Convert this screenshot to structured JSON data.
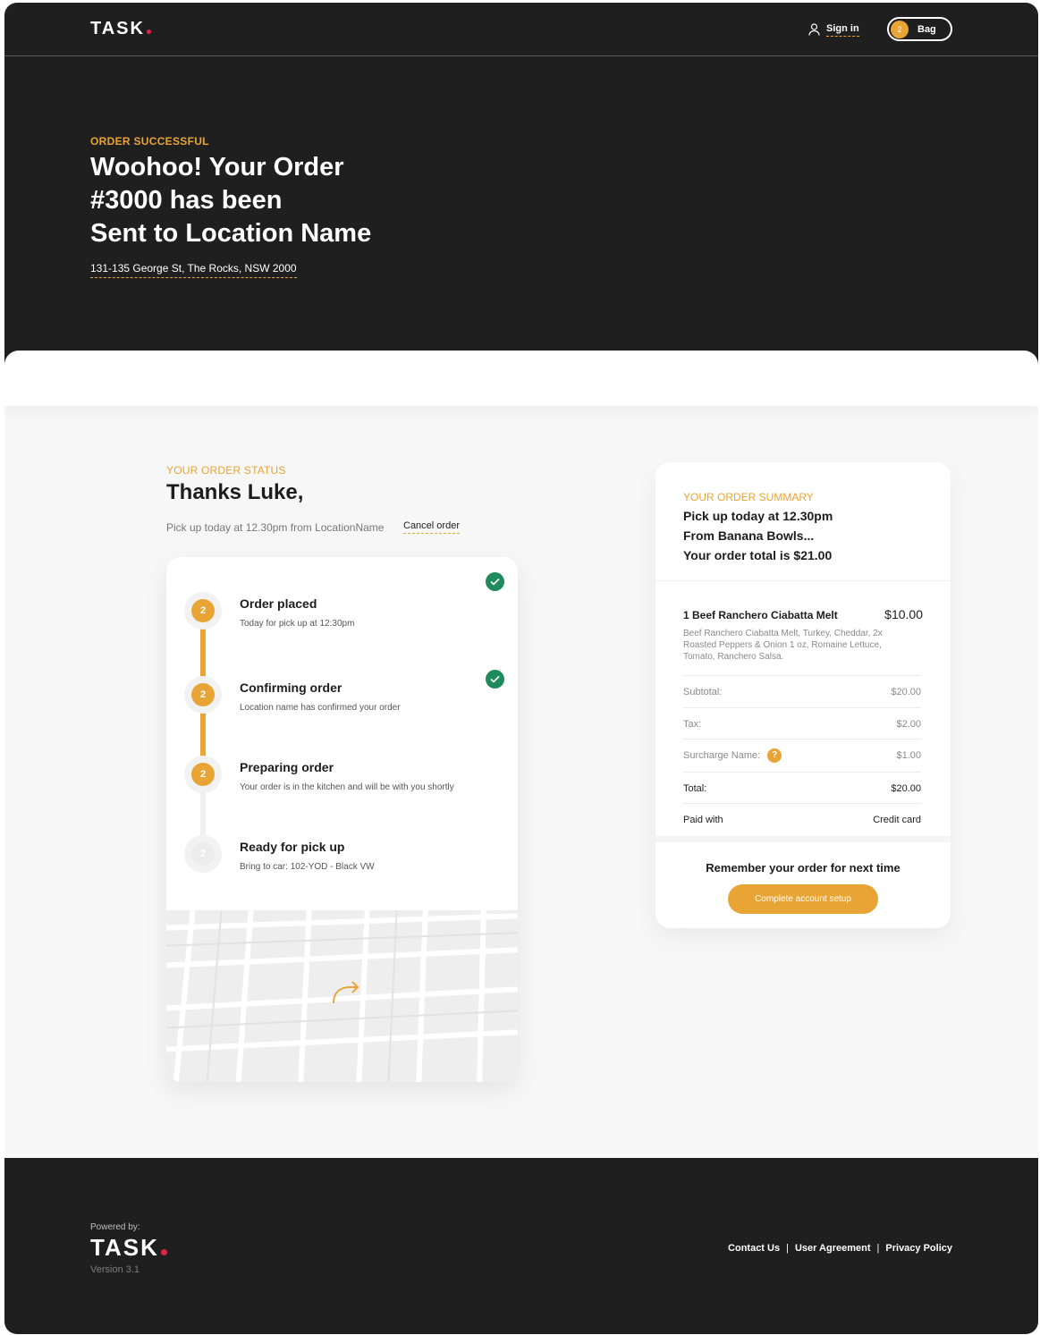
{
  "brand": {
    "name": "TASK",
    "accent": "#e8a434",
    "dot_color": "#e0234b",
    "dark_bg": "#1f1f1f",
    "success": "#1f8a5b"
  },
  "header": {
    "sign_in_label": "Sign in",
    "bag_label": "Bag",
    "bag_count": "2",
    "icons": {
      "sign_in": "user-icon"
    }
  },
  "hero": {
    "eyebrow": "ORDER SUCCESSFUL",
    "title_line1": "Woohoo! Your Order",
    "title_line2": "#3000 has been",
    "title_line3": "Sent to Location Name",
    "address": "131-135 George St, The Rocks, NSW 2000"
  },
  "status": {
    "eyebrow": "YOUR ORDER STATUS",
    "title": "Thanks Luke,",
    "subtitle": "Pick up today at 12.30pm from LocationName",
    "cancel_label": "Cancel order",
    "steps": [
      {
        "number": "2",
        "title": "Order placed",
        "description": "Today for pick up at 12:30pm",
        "state": "complete",
        "checked": true
      },
      {
        "number": "2",
        "title": "Confirming order",
        "description": "Location name has confirmed your order",
        "state": "complete",
        "checked": true
      },
      {
        "number": "2",
        "title": "Preparing order",
        "description": "Your order is in the kitchen and will be with you shortly",
        "state": "active",
        "checked": false
      },
      {
        "number": "2",
        "title": "Ready for pick up",
        "description": "Bring to car: 102-YOD - Black VW",
        "state": "pending",
        "checked": false
      }
    ],
    "map_icon": "directions-arrow-icon"
  },
  "summary": {
    "eyebrow": "YOUR ORDER SUMMARY",
    "line1": "Pick up today at 12.30pm",
    "line2": "From Banana Bowls...",
    "line3": "Your order total is $21.00",
    "item": {
      "name": "1 Beef Ranchero Ciabatta Melt",
      "price": "$10.00",
      "description": "Beef Ranchero Ciabatta Melt, Turkey, Cheddar, 2x Roasted Peppers & Onion 1 oz, Romaine Lettuce, Tomato, Ranchero Salsa."
    },
    "rows": {
      "subtotal": {
        "label": "Subtotal:",
        "value": "$20.00"
      },
      "tax": {
        "label": "Tax:",
        "value": "$2.00"
      },
      "surcharge": {
        "label": "Surcharge Name:",
        "value": "$1.00",
        "info": "?"
      },
      "total": {
        "label": "Total:",
        "value": "$20.00"
      },
      "paid": {
        "label": "Paid with",
        "value": "Credit card"
      }
    },
    "remember": "Remember your order for next time",
    "cta_label": "Complete account setup"
  },
  "footer": {
    "powered_by": "Powered by:",
    "version": "Version 3.1",
    "links": [
      "Contact Us",
      "User Agreement",
      "Privacy Policy"
    ],
    "separator": "|"
  }
}
